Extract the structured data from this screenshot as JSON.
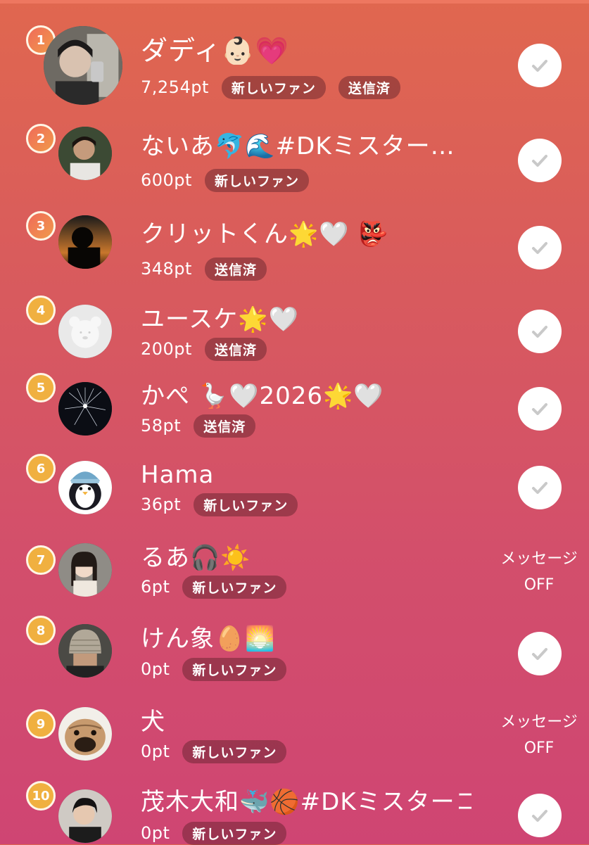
{
  "rows": [
    {
      "rank": "1",
      "name": "ダディ👶🏻💗",
      "points": "7,254pt",
      "badges": [
        "新しいファン",
        "送信済"
      ],
      "action": "check"
    },
    {
      "rank": "2",
      "name": "ないあ🐬🌊#DKミスター…",
      "points": "600pt",
      "badges": [
        "新しいファン"
      ],
      "action": "check"
    },
    {
      "rank": "3",
      "name": "クリットくん🌟🤍 👺",
      "points": "348pt",
      "badges": [
        "送信済"
      ],
      "action": "check"
    },
    {
      "rank": "4",
      "name": "ユースケ🌟🤍",
      "points": "200pt",
      "badges": [
        "送信済"
      ],
      "action": "check"
    },
    {
      "rank": "5",
      "name": "かぺ 🪿🤍2026🌟🤍",
      "points": "58pt",
      "badges": [
        "送信済"
      ],
      "action": "check"
    },
    {
      "rank": "6",
      "name": "Hama",
      "points": "36pt",
      "badges": [
        "新しいファン"
      ],
      "action": "check"
    },
    {
      "rank": "7",
      "name": "るあ🎧☀️",
      "points": "6pt",
      "badges": [
        "新しいファン"
      ],
      "action": "message_off",
      "message_line1": "メッセージ",
      "message_line2": "OFF"
    },
    {
      "rank": "8",
      "name": "けん象🥚🌅",
      "points": "0pt",
      "badges": [
        "新しいファン"
      ],
      "action": "check"
    },
    {
      "rank": "9",
      "name": "犬",
      "points": "0pt",
      "badges": [
        "新しいファン"
      ],
      "action": "message_off",
      "message_line1": "メッセージ",
      "message_line2": "OFF"
    },
    {
      "rank": "10",
      "name": "茂木大和🐳🏀#DKミスターコン",
      "points": "0pt",
      "badges": [
        "新しいファン"
      ],
      "action": "check"
    }
  ],
  "colors": {
    "gradient_top": "#e0674f",
    "gradient_bottom": "#cf4573",
    "rank_badge_gold": "#f0b040",
    "badge_bg": "rgba(90,30,40,0.45)"
  },
  "icons": {
    "check": "check-icon"
  }
}
